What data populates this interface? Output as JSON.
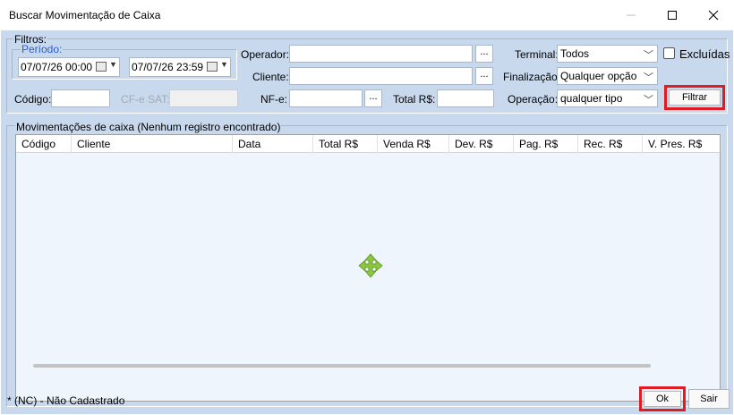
{
  "window": {
    "title": "Buscar Movimentação de Caixa"
  },
  "filters": {
    "group_label": "Filtros:",
    "periodo_label": "Período:",
    "date_from": "07/07/26 00:00",
    "date_to": "07/07/26 23:59",
    "codigo_label": "Código:",
    "cfe_label": "CF-e SAT:",
    "operador_label": "Operador:",
    "cliente_label": "Cliente:",
    "nfe_label": "NF-e:",
    "total_label": "Total R$:",
    "dots": "...",
    "terminal_label": "Terminal:",
    "terminal_value": "Todos",
    "finalizacao_label": "Finalização:",
    "finalizacao_value": "Qualquer opção",
    "operacao_label": "Operação:",
    "operacao_value": "qualquer tipo",
    "excluidas_label": "Excluídas",
    "filtrar_label": "Filtrar"
  },
  "grid": {
    "group_label": "Movimentações de caixa (Nenhum registro encontrado)",
    "columns": [
      "Código",
      "Cliente",
      "Data",
      "Total R$",
      "Venda R$",
      "Dev. R$",
      "Pag. R$",
      "Rec. R$",
      "V. Pres. R$"
    ]
  },
  "footer": {
    "legend": "* (NC) - Não Cadastrado",
    "ok_label": "Ok",
    "sair_label": "Sair"
  },
  "colors": {
    "highlight": "#e11b22",
    "client_bg": "#c8d9ee",
    "grid_bg": "#eef5fd",
    "move_icon": "#8dc63f"
  }
}
